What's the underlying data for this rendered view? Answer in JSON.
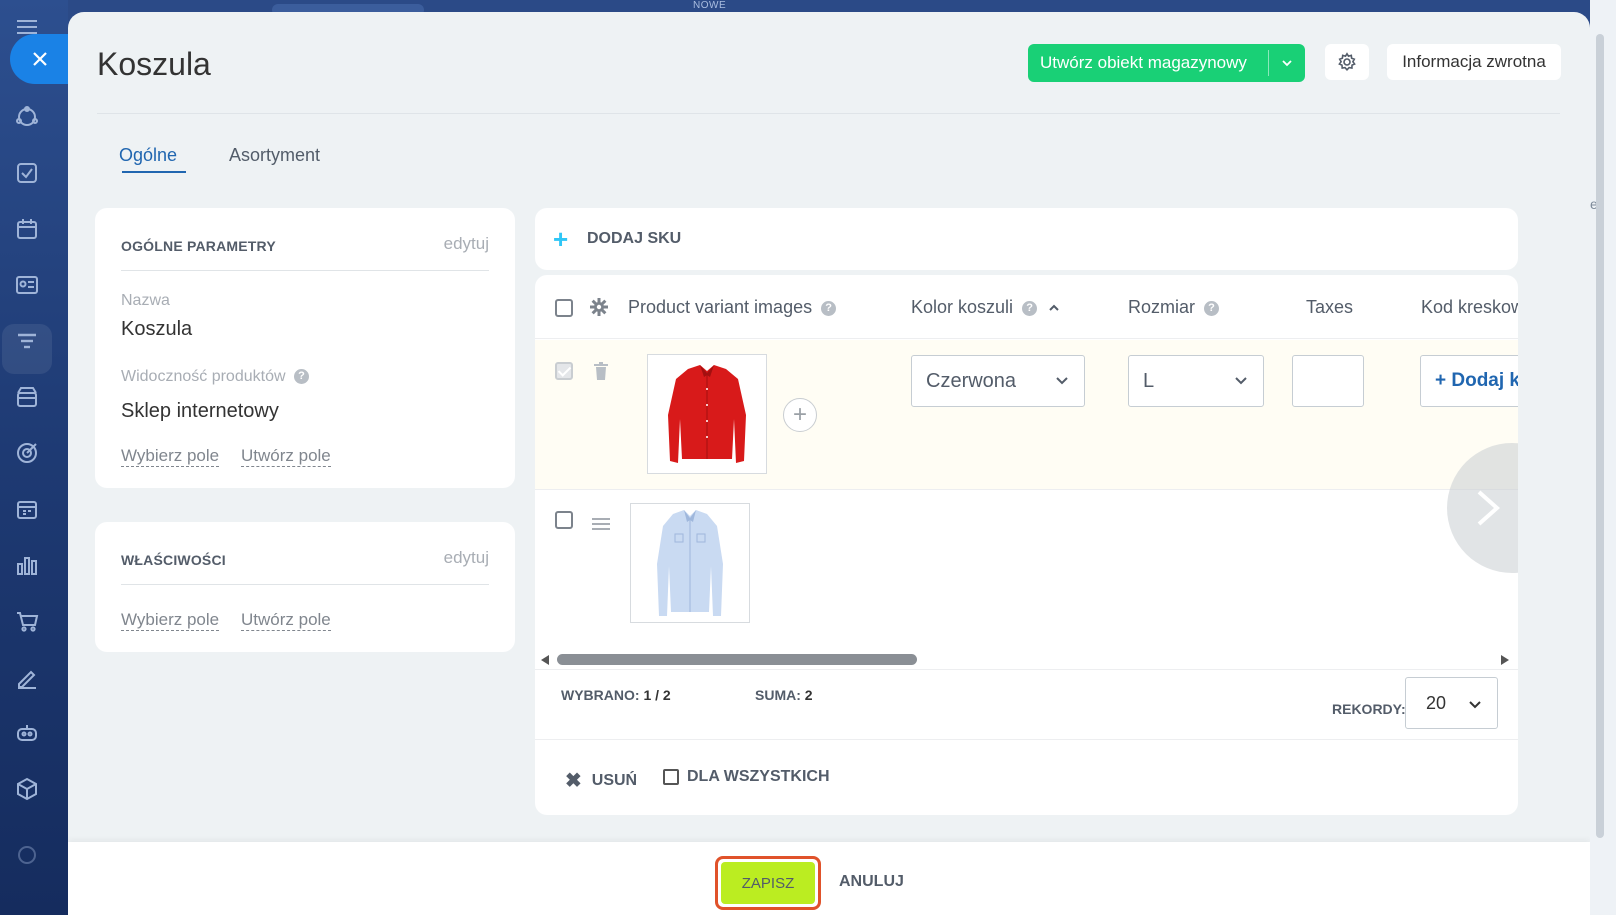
{
  "top": {
    "center_label": "NOWE"
  },
  "right_edge": {
    "clipped_char": "e"
  },
  "panel": {
    "title": "Koszula",
    "create_button": "Utwórz obiekt magazynowy",
    "feedback_button": "Informacja zwrotna",
    "colors": {
      "create": "#19d076",
      "tab_active": "#2066b0",
      "save": "#bbed21",
      "save_border": "#e0522a"
    }
  },
  "tabs": [
    {
      "label": "Ogólne",
      "active": true
    },
    {
      "label": "Asortyment",
      "active": false
    }
  ],
  "general_card": {
    "title": "OGÓLNE PARAMETRY",
    "edit": "edytuj",
    "name_label": "Nazwa",
    "name_value": "Koszula",
    "visibility_label": "Widoczność produktów",
    "visibility_value": "Sklep internetowy",
    "link_select": "Wybierz pole",
    "link_create": "Utwórz pole"
  },
  "properties_card": {
    "title": "WŁAŚCIWOŚCI",
    "edit": "edytuj",
    "link_select": "Wybierz pole",
    "link_create": "Utwórz pole"
  },
  "sku": {
    "add_label": "DODAJ SKU",
    "columns": {
      "images": "Product variant images",
      "color": "Kolor koszuli",
      "size": "Rozmiar",
      "taxes": "Taxes",
      "barcode": "Kod kreskowy"
    },
    "rows": [
      {
        "checked": true,
        "image": "red-shirt",
        "color": "Czerwona",
        "size": "L",
        "add_code": "+ Dodaj kod"
      },
      {
        "checked": false,
        "image": "blue-shirt"
      }
    ],
    "selected_label": "WYBRANO:",
    "selected_value": "1 / 2",
    "total_label": "SUMA:",
    "total_value": "2",
    "records_label": "REKORDY:",
    "records_value": "20",
    "delete_label": "USUŃ",
    "for_all_label": "DLA WSZYSTKICH"
  },
  "footer": {
    "save": "ZAPISZ",
    "cancel": "ANULUJ"
  }
}
